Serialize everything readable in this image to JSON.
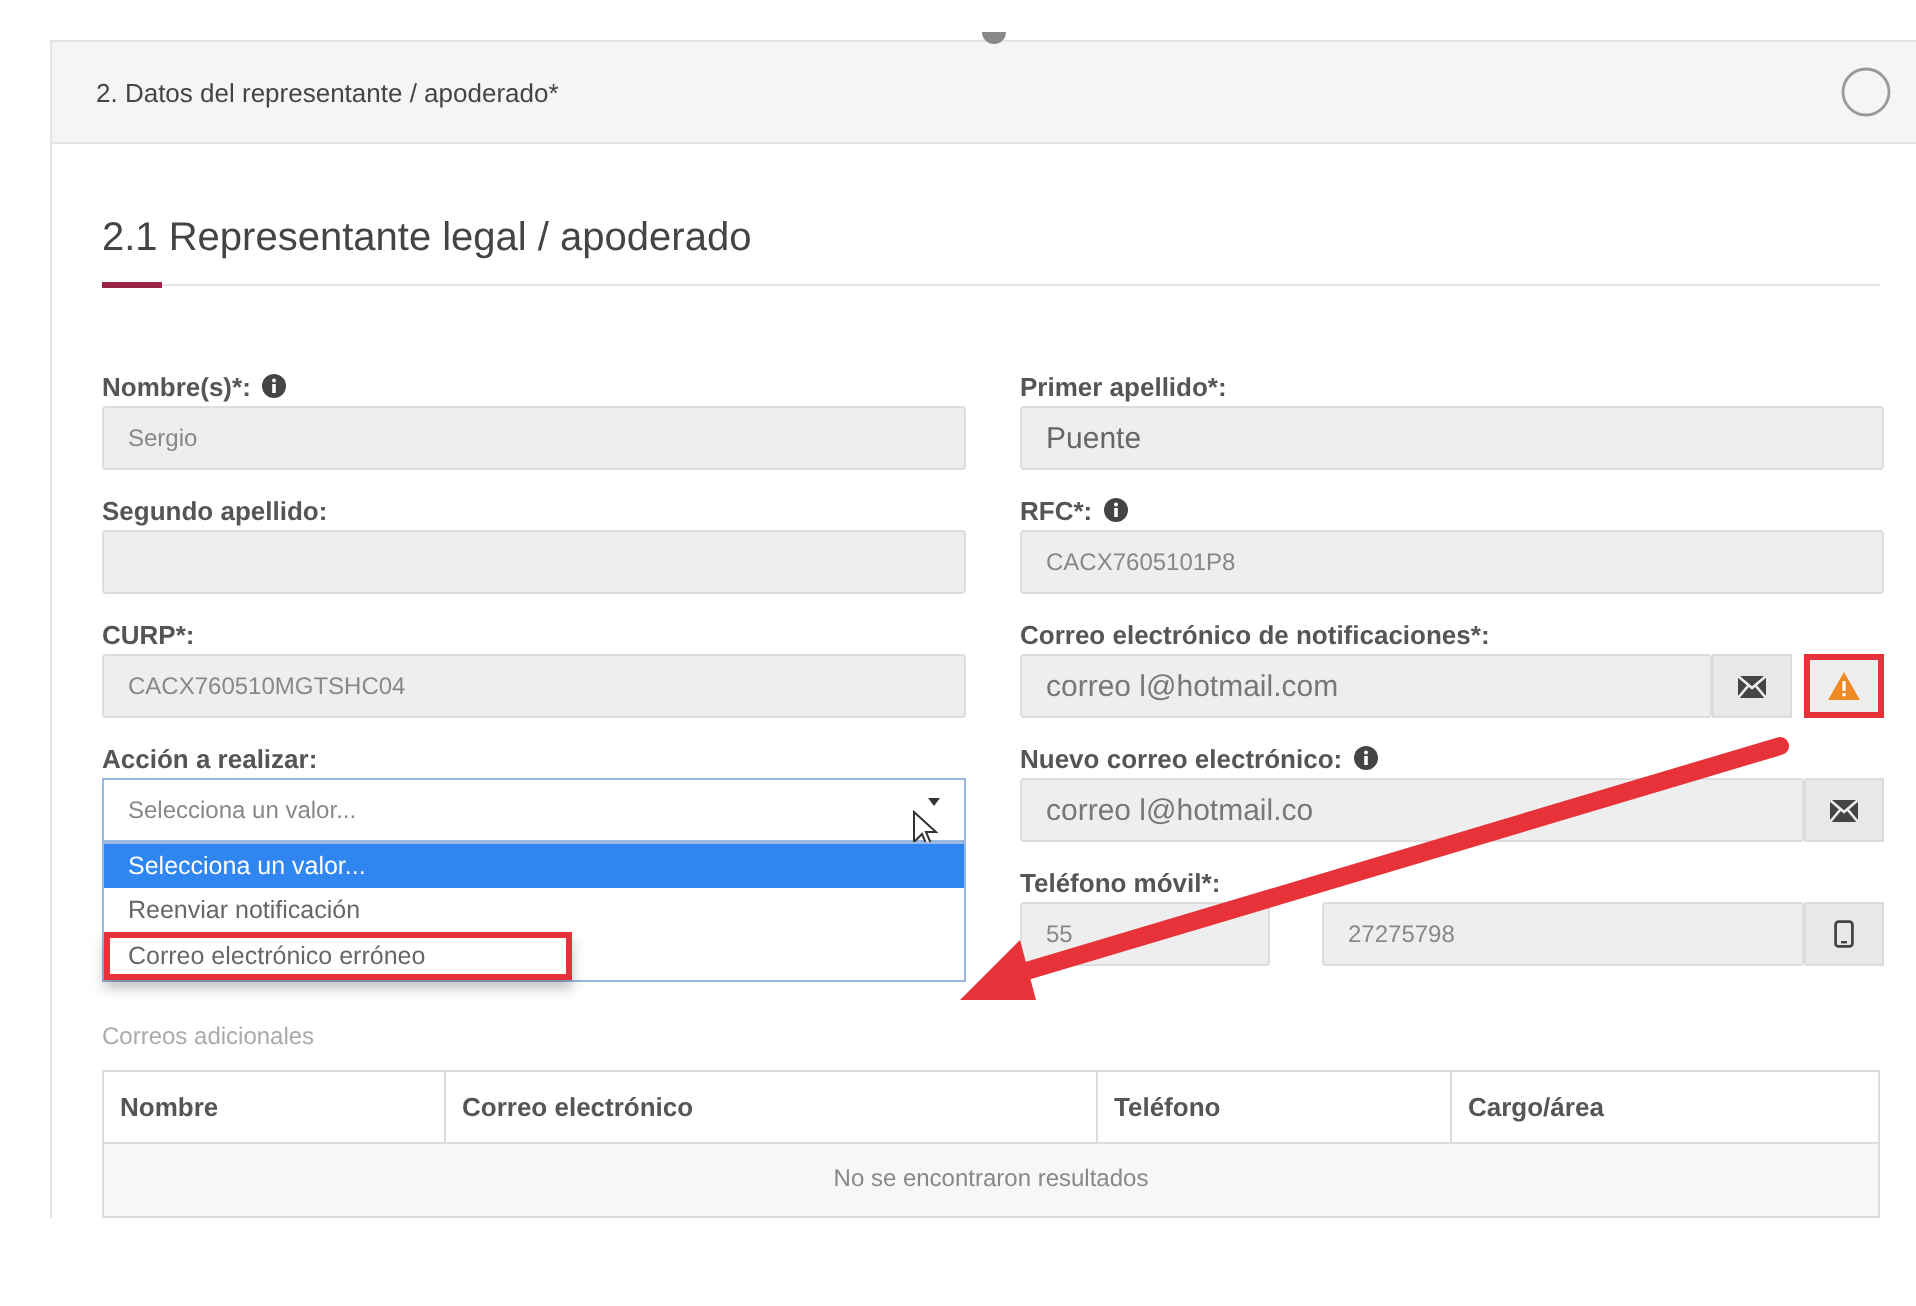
{
  "section": {
    "title": "2. Datos del representante / apoderado*",
    "completed": false
  },
  "subsection": {
    "title": "2.1 Representante legal / apoderado"
  },
  "fields": [
    {
      "kind": "text",
      "label": "Nombre(s)*:",
      "info": true,
      "value": "Sergio"
    },
    {
      "kind": "text",
      "label": "Primer apellido*:",
      "info": false,
      "value": "Puente"
    },
    {
      "kind": "text",
      "label": "Segundo apellido:",
      "info": false
    },
    {
      "kind": "text",
      "label": "RFC*:",
      "info": true,
      "value": "CACX7605101P8"
    },
    {
      "kind": "text",
      "label": "CURP*:",
      "info": false,
      "value": "CACX760510MGTSHC04"
    },
    {
      "kind": "email",
      "label": "Correo electrónico de notificaciones*:",
      "info": false,
      "value": "correo l@hotmail.com",
      "warning": true,
      "highlighted": true
    },
    {
      "kind": "select",
      "label": "Acción a realizar:",
      "info": false,
      "placeholder": "Selecciona un valor...",
      "options": [
        {
          "label": "Selecciona un valor...",
          "selected": true,
          "highlighted": false
        },
        {
          "label": "Reenviar notificación",
          "selected": false,
          "highlighted": false
        },
        {
          "label": "Correo electrónico erróneo",
          "selected": false,
          "highlighted": true
        }
      ]
    },
    {
      "kind": "email",
      "label": "Nuevo correo electrónico:",
      "info": true,
      "value": "correo l@hotmail.co"
    },
    {
      "kind": "phone",
      "label": "Teléfono móvil*:",
      "info": false,
      "lada": "55",
      "value": "27275798"
    }
  ],
  "additional": {
    "title": "Correos adicionales",
    "columns": [
      "Nombre",
      "Correo electrónico",
      "Teléfono",
      "Cargo/área"
    ],
    "empty": "No se encontraron resultados"
  }
}
